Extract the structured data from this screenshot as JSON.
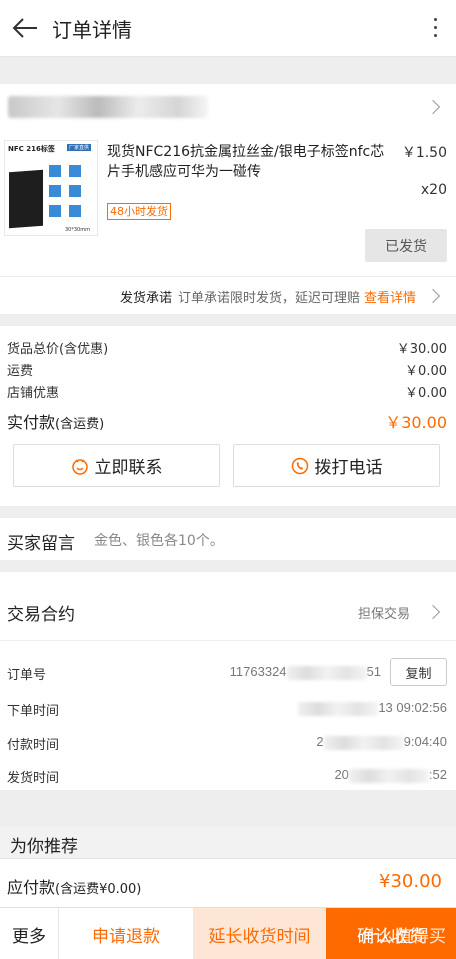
{
  "header": {
    "title": "订单详情"
  },
  "shop": {
    "name": "上海"
  },
  "goods": {
    "title": "现货NFC216抗金属拉丝金/银电子标签nfc芯片手机感应可华为一碰传",
    "price": "￥1.50",
    "qty": "x20",
    "badge": "48小时发货",
    "status_button": "已发货",
    "thumb_label": "NFC 216标签",
    "thumb_tag": "厂家直供",
    "thumb_size": "30*30mm"
  },
  "promise": {
    "label": "发货承诺",
    "text": "订单承诺限时发货，延迟可理赔",
    "link": "查看详情"
  },
  "price": {
    "rows": [
      {
        "label": "货品总价(含优惠)",
        "value": "￥30.00"
      },
      {
        "label": "运费",
        "value": "￥0.00"
      },
      {
        "label": "店铺优惠",
        "value": "￥0.00"
      }
    ],
    "paid_label": "实付款",
    "paid_sub": "(含运费)",
    "paid_value": "￥30.00",
    "contact_button": "立即联系",
    "call_button": "拨打电话"
  },
  "message": {
    "label": "买家留言",
    "text": "金色、银色各10个。"
  },
  "deal": {
    "title": "交易合约",
    "guarantee": "担保交易",
    "order_no_label": "订单号",
    "order_no_prefix": "11763324",
    "order_no_suffix": "51",
    "copy_button": "复制",
    "rows": [
      {
        "label": "下单时间",
        "prefix": "",
        "suffix": "13 09:02:56"
      },
      {
        "label": "付款时间",
        "prefix": "2",
        "suffix": "9:04:40"
      },
      {
        "label": "发货时间",
        "prefix": "20",
        "suffix": ":52"
      }
    ]
  },
  "recommend": {
    "title": "为你推荐"
  },
  "payable": {
    "label": "应付款",
    "sub": "(含运费¥0.00)",
    "value": "¥30.00"
  },
  "bottom": {
    "more": "更多",
    "refund": "申请退款",
    "extend": "延长收货时间",
    "confirm": "确认收货",
    "watermark": "什么值得买"
  },
  "colors": {
    "accent": "#ff6a00",
    "extend_bg": "#fde6d6",
    "disabled_btn": "#e6e6e6"
  }
}
